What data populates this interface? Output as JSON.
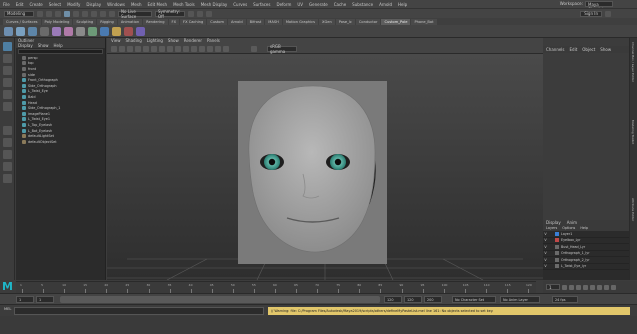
{
  "menubar": {
    "items": [
      "File",
      "Edit",
      "Create",
      "Select",
      "Modify",
      "Display",
      "Windows",
      "Mesh",
      "Edit Mesh",
      "Mesh Tools",
      "Mesh Display",
      "Curves",
      "Surfaces",
      "Deform",
      "UV",
      "Generate",
      "Cache",
      "Substance",
      "Arnold",
      "Help"
    ],
    "workspace_label": "Workspace:",
    "workspace_value": "Maya Classic*"
  },
  "statusline": {
    "mode": "Modeling",
    "no_live_surface": "No Live Surface",
    "symmetry": "Symmetry: Off",
    "sign_in": "Sign In"
  },
  "shelf": {
    "tabs": [
      "Curves / Surfaces",
      "Poly Modeling",
      "Sculpting",
      "Rigging",
      "Animation",
      "Rendering",
      "FX",
      "FX Caching",
      "Custom",
      "Arnold",
      "Bifrost",
      "MASH",
      "Motion Graphics",
      "XGen",
      "Pose_lc",
      "Conductor",
      "Custom_Pole",
      "Phone_Bot"
    ],
    "active_tab": "Custom_Pole"
  },
  "outliner": {
    "title": "Outliner",
    "menu": [
      "Display",
      "Show",
      "Help"
    ],
    "rows": [
      {
        "label": "persp",
        "icon": "camera-icon"
      },
      {
        "label": "top",
        "icon": "camera-icon"
      },
      {
        "label": "front",
        "icon": "camera-icon"
      },
      {
        "label": "side",
        "icon": "camera-icon"
      },
      {
        "label": "Front_Orthograph",
        "icon": "mesh-icon"
      },
      {
        "label": "Side_Orthograph",
        "icon": "mesh-icon"
      },
      {
        "label": "L_Twist_Eye",
        "icon": "mesh-icon"
      },
      {
        "label": "Bald",
        "icon": "mesh-icon"
      },
      {
        "label": "Head",
        "icon": "mesh-icon"
      },
      {
        "label": "Side_Orthograph_1",
        "icon": "mesh-icon"
      },
      {
        "label": "imagePlane1",
        "icon": "mesh-icon"
      },
      {
        "label": "L_Twist_Eye1",
        "icon": "mesh-icon"
      },
      {
        "label": "L_Top_Eyelash",
        "icon": "mesh-icon"
      },
      {
        "label": "L_Bot_Eyelash",
        "icon": "mesh-icon"
      },
      {
        "label": "defaultLightSet",
        "icon": "set-icon"
      },
      {
        "label": "defaultObjectSet",
        "icon": "set-icon"
      }
    ]
  },
  "viewport": {
    "menu": [
      "View",
      "Shading",
      "Lighting",
      "Show",
      "Renderer",
      "Panels"
    ],
    "color_space": "sRGB gamma",
    "camera_label": "persp"
  },
  "channel_box": {
    "tabs": [
      "Channels",
      "Edit",
      "Object",
      "Show"
    ]
  },
  "side_tabs": [
    "Channel Box / Layer Editor",
    "Modeling Toolkit",
    "Attribute Editor"
  ],
  "layer_editor": {
    "tabs": [
      "Display",
      "Anim"
    ],
    "menu": [
      "Layers",
      "Options",
      "Help"
    ],
    "rows": [
      {
        "v": "V",
        "p": "",
        "name": "Layer1",
        "color": "#3a7fd6"
      },
      {
        "v": "V",
        "p": "",
        "name": "Eyelbox_Lyr",
        "color": "#c04848"
      },
      {
        "v": "V",
        "p": "",
        "name": "Bust_Head_Lyr",
        "color": "#6a6a6a"
      },
      {
        "v": "V",
        "p": "",
        "name": "Orthograph_1_lyr",
        "color": "#6a6a6a"
      },
      {
        "v": "V",
        "p": "",
        "name": "Orthograph_2_lyr",
        "color": "#6a6a6a"
      },
      {
        "v": "V",
        "p": "",
        "name": "L_Twist_Eye_lyr",
        "color": "#6a6a6a"
      }
    ]
  },
  "timeline": {
    "ticks": [
      "1",
      "5",
      "10",
      "15",
      "20",
      "25",
      "30",
      "35",
      "40",
      "45",
      "50",
      "55",
      "60",
      "65",
      "70",
      "75",
      "80",
      "85",
      "90",
      "95",
      "100",
      "105",
      "110",
      "115",
      "120"
    ],
    "current_frame": "1"
  },
  "range": {
    "start": "1",
    "inner_start": "1",
    "inner_end": "120",
    "end": "120",
    "end2": "200",
    "character_set": "No Character Set",
    "anim_layer": "No Anim Layer",
    "fps": "24 fps"
  },
  "commandline": {
    "mel_label": "MEL",
    "result": "// Warning: file: C:/Program Files/Autodesk/Maya2019/scripts/others/defineMyPasteList.mel line 161: No objects selected to set key."
  },
  "logo": "M"
}
